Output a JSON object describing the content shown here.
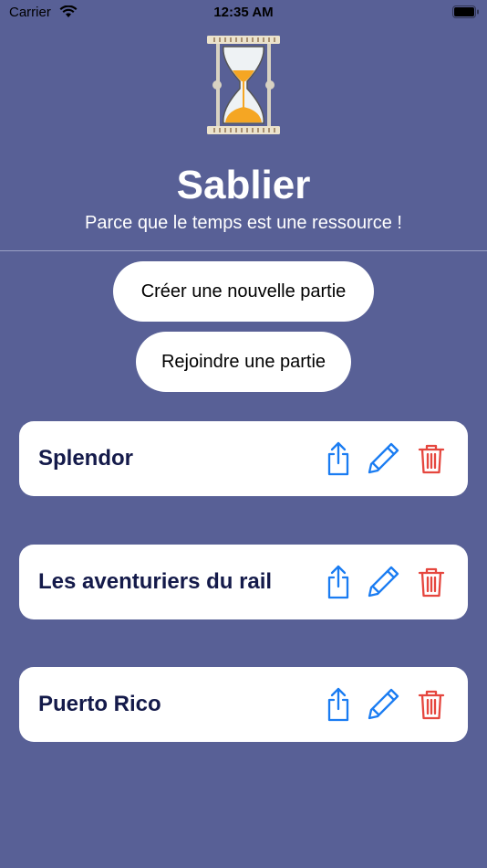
{
  "status_bar": {
    "carrier": "Carrier",
    "time": "12:35 AM"
  },
  "header": {
    "title": "Sablier",
    "subtitle": "Parce que le temps est une ressource !"
  },
  "actions": {
    "create_label": "Créer une nouvelle partie",
    "join_label": "Rejoindre une partie"
  },
  "games": [
    {
      "name": "Splendor"
    },
    {
      "name": "Les aventuriers du rail"
    },
    {
      "name": "Puerto Rico"
    }
  ],
  "colors": {
    "background": "#586096",
    "action_blue": "#1a7cf2",
    "delete_red": "#e5463e",
    "card_text": "#141a4a",
    "sand": "#f5a623"
  },
  "icons": [
    "hourglass-logo",
    "share-icon",
    "pencil-icon",
    "trash-icon",
    "wifi-icon",
    "battery-icon"
  ]
}
